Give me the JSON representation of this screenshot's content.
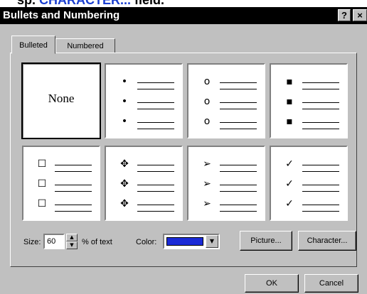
{
  "context": {
    "caption_prefix": "sp. ",
    "caption_keyword": "CHARACTER...",
    "caption_suffix": " field."
  },
  "window": {
    "title": "Bullets and Numbering",
    "help_label": "?",
    "close_label": "×"
  },
  "tabs": [
    {
      "label": "Bulleted",
      "active": true
    },
    {
      "label": "Numbered",
      "active": false
    }
  ],
  "bullet_grid": {
    "none_label": "None",
    "styles": [
      {
        "glyph": "•",
        "icon": "filled-circle-bullet-icon"
      },
      {
        "glyph": "o",
        "icon": "hollow-circle-bullet-icon"
      },
      {
        "glyph": "▪",
        "icon": "square-bullet-icon"
      },
      {
        "glyph": "☐",
        "icon": "hollow-square-bullet-icon"
      },
      {
        "glyph": "✥",
        "icon": "four-diamond-bullet-icon"
      },
      {
        "glyph": "➢",
        "icon": "arrowhead-bullet-icon"
      },
      {
        "glyph": "✓",
        "icon": "checkmark-bullet-icon"
      }
    ],
    "selected_index": 0
  },
  "size": {
    "label": "Size:",
    "value": "60",
    "suffix": "% of text"
  },
  "color": {
    "label": "Color:",
    "value_hex": "#1a2ad6"
  },
  "buttons": {
    "picture": "Picture...",
    "character": "Character...",
    "ok": "OK",
    "cancel": "Cancel"
  }
}
